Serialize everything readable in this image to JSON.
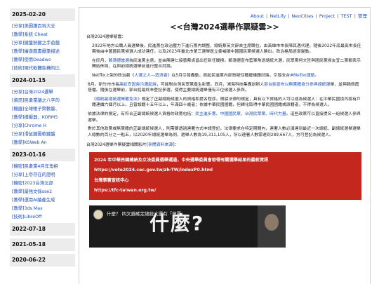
{
  "sidebar": {
    "groups": [
      {
        "date": "2025-02-20",
        "links": [
          "[分享]美圖讚百科大全",
          "[教學]系統 Cheat",
          "[分享]鍵盤熱鍵之手遊戲",
          "[教學]繪遊戲書攝筆描述",
          "[教學]使用Deadwo",
          "[技術]現代軟體架構的比"
        ]
      },
      {
        "date": "2024-01-15",
        "links": [
          "[分享]台灣2024選舉",
          "[資訊]民衆黨議之八字的",
          "[機器]全球帳子弊數量、",
          "[教學]模擬器，KORMS",
          "[分享]Chrome H",
          "[分享]滑鼠鍵圖軟鍵盤",
          "[教學]KSWeb An"
        ]
      },
      {
        "date": "2023-01-16",
        "links": [
          "[機密]民衆黨4月年角相",
          "[分享]上帝存在的證明",
          "[機密]2023台灣北部",
          "[教學]最強文採sse2",
          "[教學]運用AI繪產生成",
          "[教學]3ds Max",
          "[技術]LibreOff"
        ]
      },
      {
        "date": "2022-07-18",
        "links": []
      },
      {
        "date": "2021-05-18",
        "links": []
      },
      {
        "date": "2020-06-22",
        "links": []
      }
    ]
  },
  "topnav": {
    "links": [
      "About",
      "NetLify",
      "NeoCities",
      "Project",
      "TEST",
      "管理"
    ]
  },
  "post": {
    "title": "<<台灣2024選舉作票疑雲>>",
    "intro": "台灣2024選舉疑雲：",
    "p1": "2022年地方公職人員選舉後，民進黨在政治壓力下進行黨內調整，總統蔡英文辭去主席職位。由高雄市市長陳其邁代理。隨後2022年底最高市長任期後由中國國民黨候選人成功連任，以及2023年臺北市第三選舉區立委補選中國國民黨候選人勝出，政治格局逐漸變動。",
    "p2_pre": "在同月，",
    "p2_link": "賴清德當選",
    "p2_post": "為民進黨主席，並由陳建仁接替蘇貞昌出任新任閣揆。賴清德宣布藍軍角逐總統大選，民眾黨柯文哲與國民黨侯友宜二黨都表示開始佈局，在與前總統選舉前進行整合討論。",
    "p3_pre": "Netflix上架的政治劇",
    "p3_link": "《人選之人—造浪者》",
    "p3_post": "在5月引發轟動，掀起民進黨內部質疑性騷擾議題討論，引發全台",
    "p3_tag": "#MeToo運動",
    "p3_end": "。",
    "p4_pre": "8月，新竹市市長",
    "p4_link1": "高虹安因貪污遭起訴",
    "p4_mid": "，可能對台灣民眾黨產生影響。同月，鴻海科技集團創辦人",
    "p4_link2": "郭台銘宣布以無黨籍身分參與總統",
    "p4_link3": "選",
    "p4_post": "舉，並與賴佩霞搭檔。隨後在選舉前，郭台銘最終未登記參選，使得主要總統選舉僅有三位候選人參與。",
    "p5_link": "《總統副總統選舉罷免法》",
    "p5_post": "規定了正副總統候選人的資格和提名程序。根據法律的規定，具有以下資格的人可以成為候選人：在中華民國境內設有戶籍連續六個月以上，且曾設籍十五年以上，年滿四十歲者；依據中華民國國籍，但歸化取得中華民國國籍或原籍者，不得為候選人。",
    "p6_pre": "依據法律的規定，有符合正副總統候選人資格的政黨包括：",
    "p6_link": "民主進步黨、中國國民黨、台灣民眾黨、時代力量",
    "p6_post": "。這些政黨可以直接提名一組候選人參與選舉。",
    "p7": "對於其他政黨或無黨籍的正副總統候選人，則需要透過連署方式申請登記。法律要求在特定期間內，連署人數必須達到最近一次總統、副總統選舉選舉人總數的百分之一點五，以2020年總統選舉為例，選舉人數為19,311,105人，所以連署人數需達到289,667人，方可登記為候選人。",
    "result_pre": "台灣2024選舉作票疑雲相關影片[",
    "result_link": "參閱資料來源",
    "result_post": "]："
  },
  "banner": {
    "line1": "2024 年中華民國總統及立法委員選舉選過，中央選舉委員會取得有關選舉結果的最新資訊",
    "line2": "https://vote2024.cec.gov.tw/zh-TW/indexP0.html",
    "line3": "台灣事實查核中心",
    "line4": "https://tfc-taiwan.org.tw/"
  },
  "video": {
    "title": "什麼？ 四叉錨確定總統大選有「做票」",
    "big": "什麼?"
  }
}
